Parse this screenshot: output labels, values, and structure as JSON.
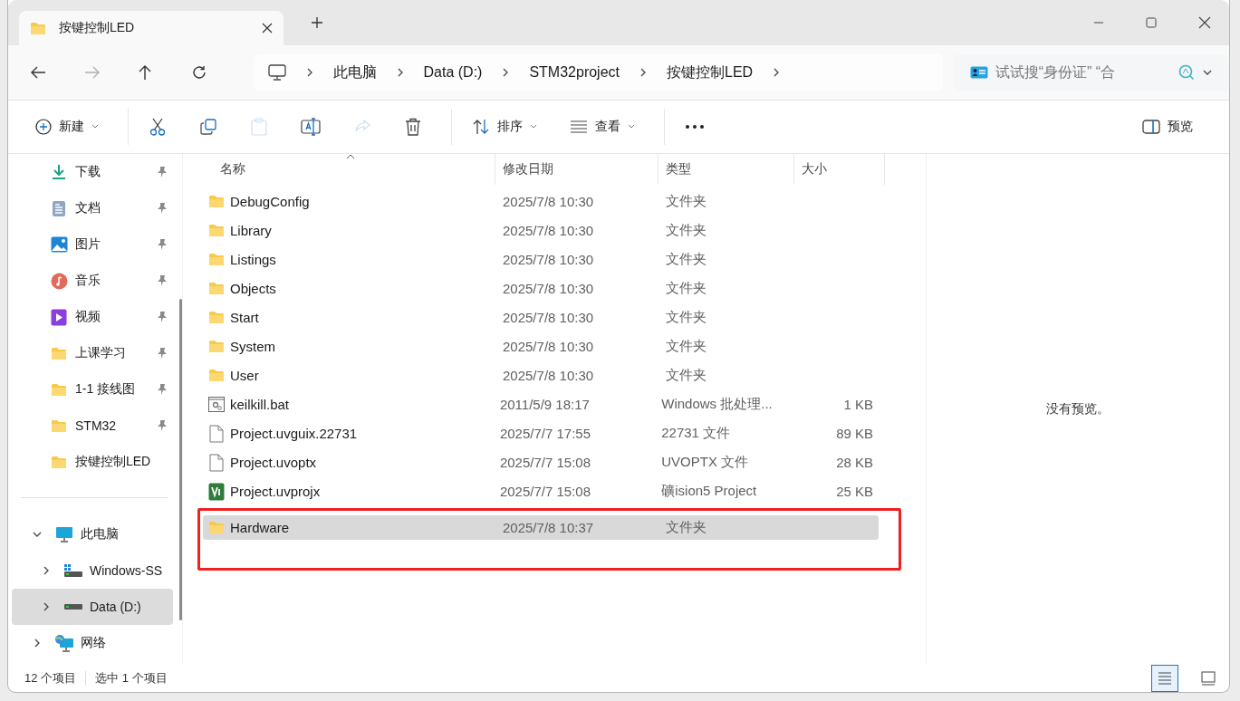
{
  "tab": {
    "title": "按键控制LED"
  },
  "nav": [
    {
      "kind": "back",
      "disabled": false
    },
    {
      "kind": "forward",
      "disabled": true
    },
    {
      "kind": "up",
      "disabled": false
    },
    {
      "kind": "refresh",
      "disabled": false
    }
  ],
  "breadcrumb": [
    "此电脑",
    "Data (D:)",
    "STM32project",
    "按键控制LED"
  ],
  "search": {
    "placeholder": "试试搜“身份证” “合"
  },
  "toolbar": [
    {
      "kind": "new",
      "label": "新建",
      "disabled": false
    },
    {
      "kind": "cut",
      "disabled": false
    },
    {
      "kind": "copy",
      "disabled": false
    },
    {
      "kind": "paste",
      "disabled": true
    },
    {
      "kind": "rename",
      "disabled": false
    },
    {
      "kind": "share",
      "disabled": true
    },
    {
      "kind": "delete",
      "disabled": false
    },
    {
      "kind": "sort",
      "label": "排序",
      "disabled": false
    },
    {
      "kind": "view",
      "label": "查看",
      "disabled": false
    },
    {
      "kind": "more",
      "disabled": false
    }
  ],
  "preview_button": {
    "label": "预览"
  },
  "quick_access": [
    {
      "kind": "download",
      "label": "下载",
      "pinned": true
    },
    {
      "kind": "documents",
      "label": "文档",
      "pinned": true
    },
    {
      "kind": "pictures",
      "label": "图片",
      "pinned": true
    },
    {
      "kind": "music",
      "label": "音乐",
      "pinned": true
    },
    {
      "kind": "videos",
      "label": "视频",
      "pinned": true
    },
    {
      "kind": "folder",
      "label": "上课学习",
      "pinned": true
    },
    {
      "kind": "folder",
      "label": "1-1 接线图",
      "pinned": true
    },
    {
      "kind": "folder",
      "label": "STM32",
      "pinned": true
    },
    {
      "kind": "folder",
      "label": "按键控制LED",
      "pinned": false
    }
  ],
  "tree": [
    {
      "kind": "pc",
      "label": "此电脑",
      "expanded": true,
      "selected": false,
      "children": [
        {
          "kind": "windows-drive",
          "label": "Windows-SS",
          "expanded": false,
          "selected": false
        },
        {
          "kind": "drive",
          "label": "Data (D:)",
          "expanded": false,
          "selected": true
        }
      ]
    },
    {
      "kind": "network",
      "label": "网络",
      "expanded": false,
      "selected": false
    }
  ],
  "columns": [
    {
      "label": "名称",
      "sorted": true
    },
    {
      "label": "修改日期",
      "sorted": false
    },
    {
      "label": "类型",
      "sorted": false
    },
    {
      "label": "大小",
      "sorted": false
    }
  ],
  "rows": [
    {
      "kind": "folder",
      "name": "DebugConfig",
      "date": "2025/7/8 10:30",
      "type": "文件夹",
      "selected": false,
      "outlined": false
    },
    {
      "kind": "folder",
      "name": "Library",
      "date": "2025/7/8 10:30",
      "type": "文件夹",
      "selected": false,
      "outlined": false
    },
    {
      "kind": "folder",
      "name": "Listings",
      "date": "2025/7/8 10:30",
      "type": "文件夹",
      "selected": false,
      "outlined": false
    },
    {
      "kind": "folder",
      "name": "Objects",
      "date": "2025/7/8 10:30",
      "type": "文件夹",
      "selected": false,
      "outlined": false
    },
    {
      "kind": "folder",
      "name": "Start",
      "date": "2025/7/8 10:30",
      "type": "文件夹",
      "selected": false,
      "outlined": false
    },
    {
      "kind": "folder",
      "name": "System",
      "date": "2025/7/8 10:30",
      "type": "文件夹",
      "selected": false,
      "outlined": false
    },
    {
      "kind": "folder",
      "name": "User",
      "date": "2025/7/8 10:30",
      "type": "文件夹",
      "selected": false,
      "outlined": false
    },
    {
      "kind": "bat",
      "name": "keilkill.bat",
      "date": "2011/5/9 18:17",
      "type": "Windows 批处理...",
      "size": "1 KB",
      "selected": false,
      "outlined": false
    },
    {
      "kind": "file",
      "name": "Project.uvguix.22731",
      "date": "2025/7/7 17:55",
      "type": "22731 文件",
      "size": "89 KB",
      "selected": false,
      "outlined": false
    },
    {
      "kind": "file",
      "name": "Project.uvoptx",
      "date": "2025/7/7 15:08",
      "type": "UVOPTX 文件",
      "size": "28 KB",
      "selected": false,
      "outlined": false
    },
    {
      "kind": "project",
      "name": "Project.uvprojx",
      "date": "2025/7/7 15:08",
      "type": "礦ision5 Project",
      "size": "25 KB",
      "selected": false,
      "outlined": false
    },
    {
      "kind": "folder",
      "name": "Hardware",
      "date": "2025/7/8 10:37",
      "type": "文件夹",
      "selected": true,
      "outlined": true
    }
  ],
  "preview": {
    "message": "没有预览。"
  },
  "status": {
    "count": "12 个项目",
    "selection": "选中 1 个项目"
  },
  "views": [
    {
      "kind": "details",
      "selected": true
    },
    {
      "kind": "tiles",
      "selected": false
    }
  ]
}
